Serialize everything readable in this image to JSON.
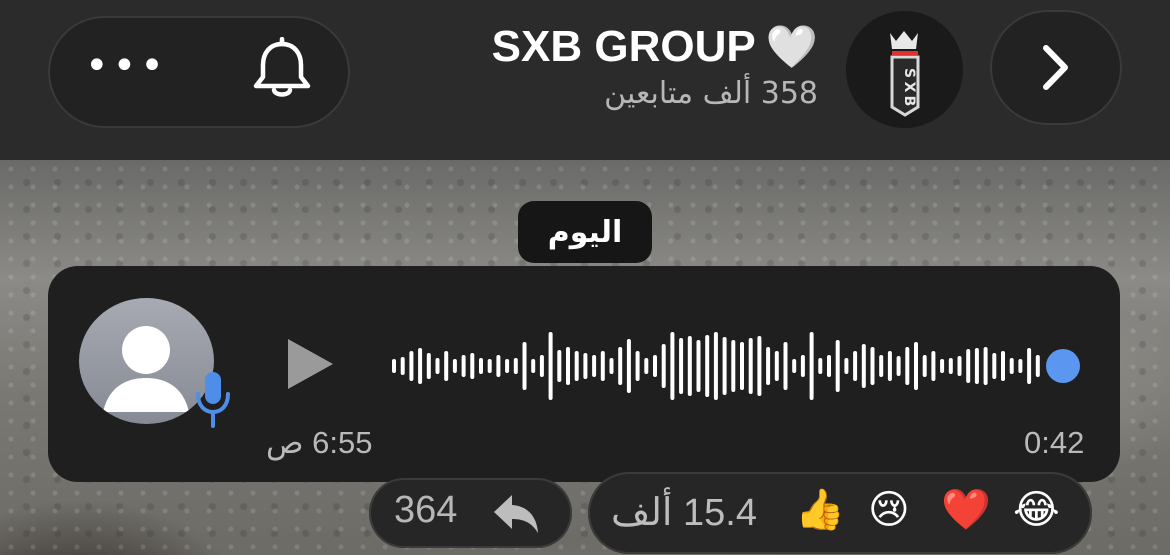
{
  "header": {
    "channel_name": "SXB GROUP",
    "verified_emoji": "🤍",
    "followers": "358 ألف متابعين",
    "menu_icon": "more-dots-icon",
    "bell_icon": "bell-icon",
    "next_icon": "chevron-right-icon"
  },
  "date_chip": "اليوم",
  "voice_message": {
    "duration": "0:42",
    "sent_time": "6:55 ص",
    "progress": 0.0,
    "accent": "#5b97f0"
  },
  "reactions": {
    "reply_count": "364",
    "total": "15.4 ألف",
    "emojis": [
      "👍",
      "😢",
      "❤️",
      "😂"
    ]
  }
}
